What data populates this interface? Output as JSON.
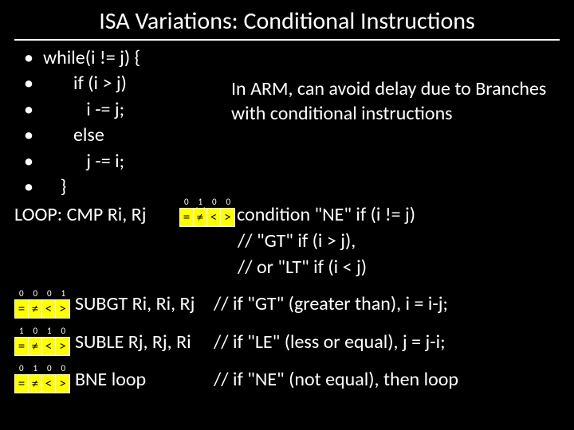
{
  "title": "ISA Variations: Conditional Instructions",
  "bullets": [
    "while(i != j) {",
    "       if (i > j)",
    "          i -= j;",
    "       else",
    "          j -= i;",
    "    }"
  ],
  "note": "In ARM, can avoid delay due to Branches with conditional instructions",
  "flag_symbols": [
    "=",
    "≠",
    "<",
    ">"
  ],
  "loop": {
    "label": "LOOP: CMP Ri, Rj",
    "bits": [
      "0",
      "1",
      "0",
      "0"
    ],
    "comment": "// set condition \"NE\" if (i != j)"
  },
  "extra_comments": [
    "//  \"GT\" if (i > j),",
    "// or \"LT\" if (i < j)"
  ],
  "asm": [
    {
      "bits": [
        "0",
        "0",
        "0",
        "1"
      ],
      "instr": "SUBGT Ri, Ri, Rj",
      "comment": "// if \"GT\" (greater than), i = i-j;"
    },
    {
      "bits": [
        "1",
        "0",
        "1",
        "0"
      ],
      "instr": "SUBLE Rj, Rj, Ri",
      "comment": "// if \"LE\" (less or equal), j = j-i;"
    },
    {
      "bits": [
        "0",
        "1",
        "0",
        "0"
      ],
      "instr": "BNE loop",
      "comment": "// if \"NE\" (not equal), then loop"
    }
  ]
}
